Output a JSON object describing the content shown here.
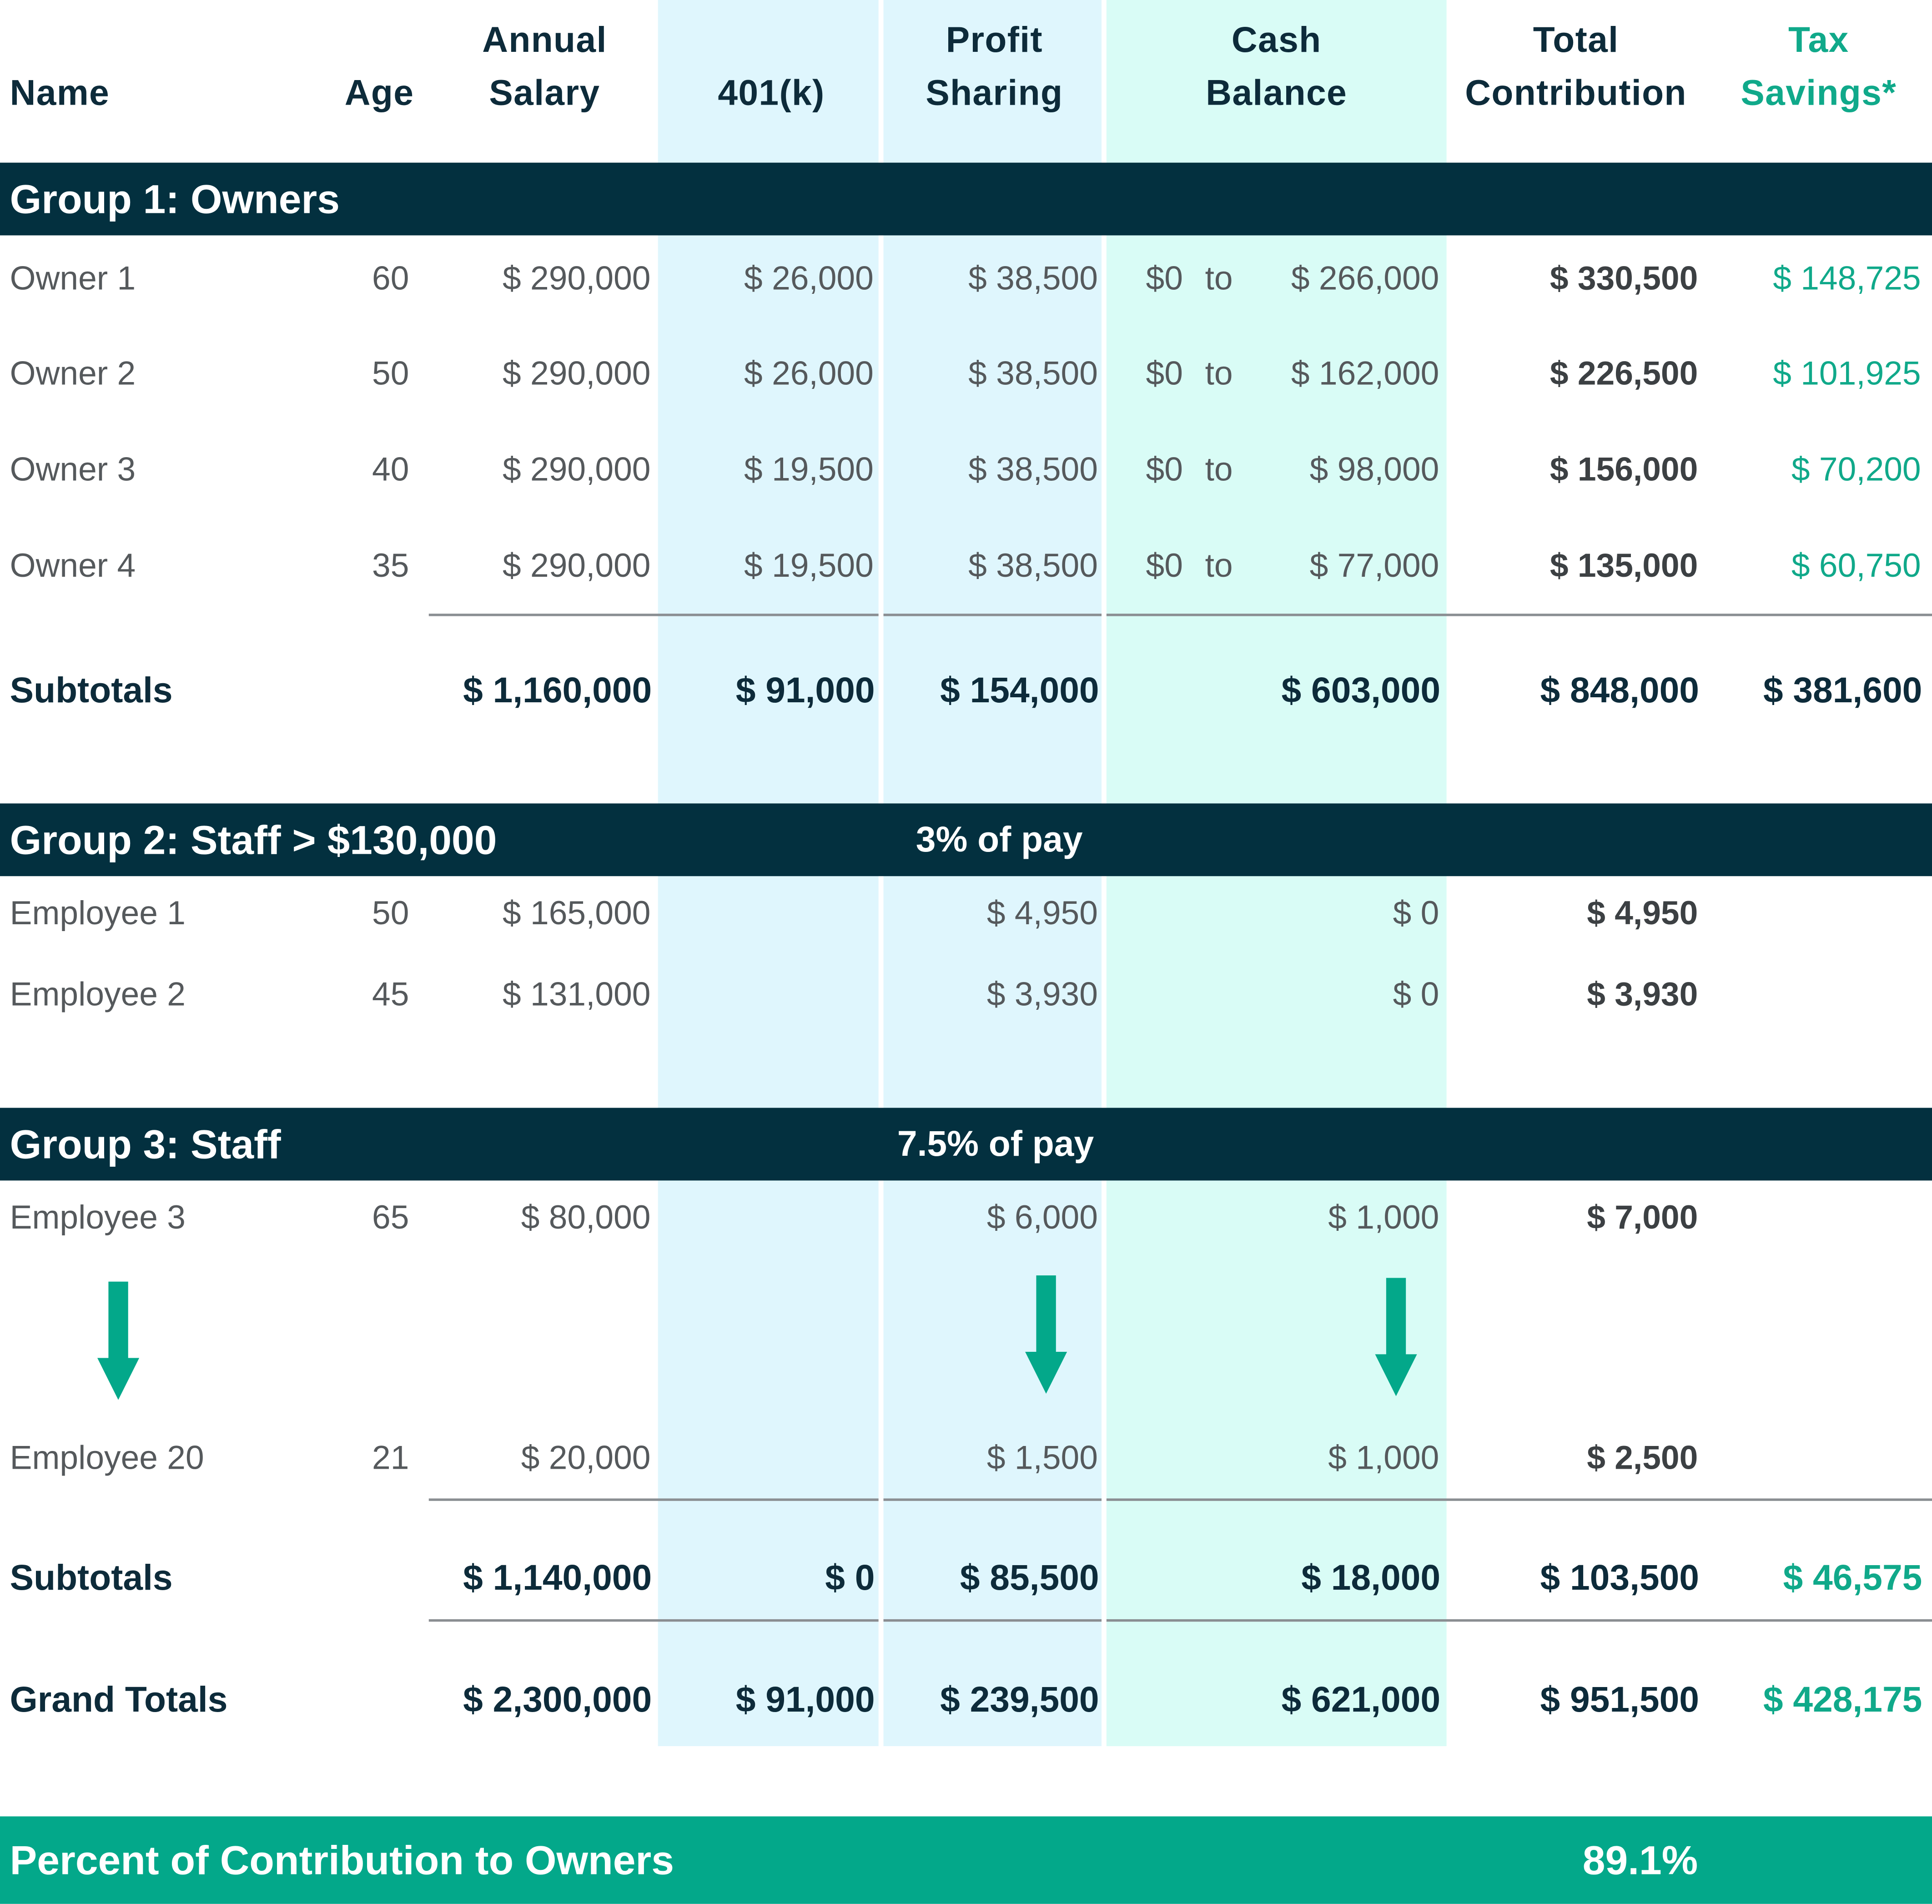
{
  "headers": {
    "name": "Name",
    "age": "Age",
    "salary_1": "Annual",
    "salary_2": "Salary",
    "k401": "401(k)",
    "ps_1": "Profit",
    "ps_2": "Sharing",
    "cb_1": "Cash",
    "cb_2": "Balance",
    "total_1": "Total",
    "total_2": "Contribution",
    "tax_1": "Tax",
    "tax_2": "Savings*"
  },
  "group1": {
    "title": "Group 1: Owners",
    "rows": [
      {
        "name": "Owner 1",
        "age": "60",
        "salary": "$ 290,000",
        "k401": "$ 26,000",
        "ps": "$ 38,500",
        "cb_from": "$0",
        "cb_to": "to",
        "cb_max": "$ 266,000",
        "total": "$ 330,500",
        "tax": "$ 148,725"
      },
      {
        "name": "Owner 2",
        "age": "50",
        "salary": "$ 290,000",
        "k401": "$ 26,000",
        "ps": "$ 38,500",
        "cb_from": "$0",
        "cb_to": "to",
        "cb_max": "$ 162,000",
        "total": "$ 226,500",
        "tax": "$ 101,925"
      },
      {
        "name": "Owner 3",
        "age": "40",
        "salary": "$ 290,000",
        "k401": "$ 19,500",
        "ps": "$ 38,500",
        "cb_from": "$0",
        "cb_to": "to",
        "cb_max": "$ 98,000",
        "total": "$ 156,000",
        "tax": "$ 70,200"
      },
      {
        "name": "Owner 4",
        "age": "35",
        "salary": "$ 290,000",
        "k401": "$ 19,500",
        "ps": "$ 38,500",
        "cb_from": "$0",
        "cb_to": "to",
        "cb_max": "$ 77,000",
        "total": "$ 135,000",
        "tax": "$ 60,750"
      }
    ],
    "subtotal": {
      "label": "Subtotals",
      "salary": "$ 1,160,000",
      "k401": "$ 91,000",
      "ps": "$ 154,000",
      "cb": "$ 603,000",
      "total": "$ 848,000",
      "tax": "$ 381,600"
    }
  },
  "group2": {
    "title": "Group 2: Staff > $130,000",
    "note": "3% of pay",
    "rows": [
      {
        "name": "Employee 1",
        "age": "50",
        "salary": "$ 165,000",
        "ps": "$ 4,950",
        "cb": "$ 0",
        "total": "$ 4,950"
      },
      {
        "name": "Employee 2",
        "age": "45",
        "salary": "$ 131,000",
        "ps": "$ 3,930",
        "cb": "$ 0",
        "total": "$ 3,930"
      }
    ]
  },
  "group3": {
    "title": "Group 3: Staff",
    "note": "7.5% of pay",
    "rows": [
      {
        "name": "Employee 3",
        "age": "65",
        "salary": "$ 80,000",
        "ps": "$ 6,000",
        "cb": "$ 1,000",
        "total": "$ 7,000"
      },
      {
        "name": "Employee 20",
        "age": "21",
        "salary": "$ 20,000",
        "ps": "$ 1,500",
        "cb": "$ 1,000",
        "total": "$ 2,500"
      }
    ],
    "subtotal": {
      "label": "Subtotals",
      "salary": "$ 1,140,000",
      "k401": "$ 0",
      "ps": "$ 85,500",
      "cb": "$ 18,000",
      "total": "$ 103,500",
      "tax": "$ 46,575"
    }
  },
  "grand_totals": {
    "label": "Grand Totals",
    "salary": "$ 2,300,000",
    "k401": "$ 91,000",
    "ps": "$ 239,500",
    "cb": "$ 621,000",
    "total": "$ 951,500",
    "tax": "$ 428,175"
  },
  "footer": {
    "label": "Percent of Contribution to Owners",
    "value": "89.1%"
  },
  "icons": {
    "arrow": "down-arrow-icon"
  },
  "colors": {
    "navy": "#03303f",
    "teal": "#03a88a",
    "teal_text": "#10a98a",
    "light_blue": "#dff6fd",
    "light_mint": "#d9fcf6"
  }
}
